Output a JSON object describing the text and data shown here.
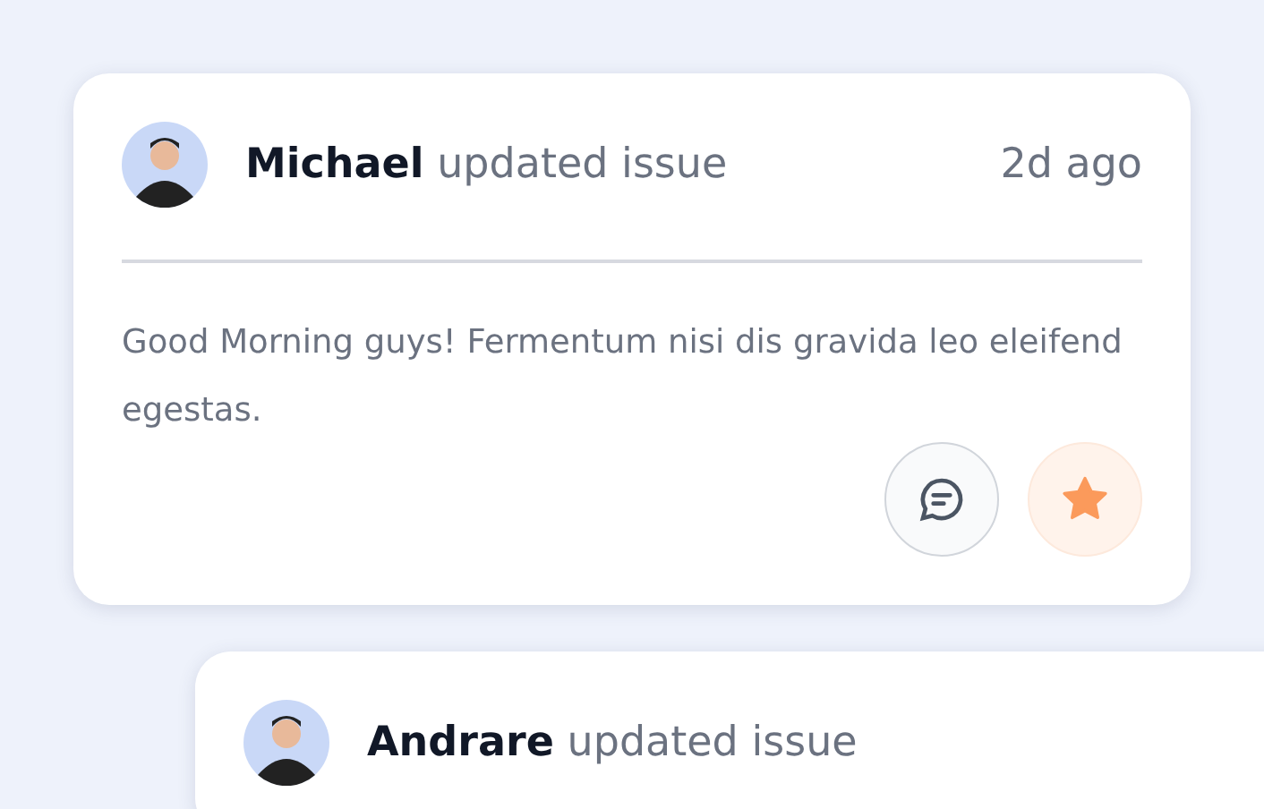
{
  "cards": [
    {
      "headline": "**Michael** updated issue",
      "time": "2d ago",
      "message": "Good Morning guys! Fermentum nisi dis gravida leo eleifend egestas.",
      "starred": true
    },
    {
      "headline": "**Andrare** updated issue"
    }
  ]
}
